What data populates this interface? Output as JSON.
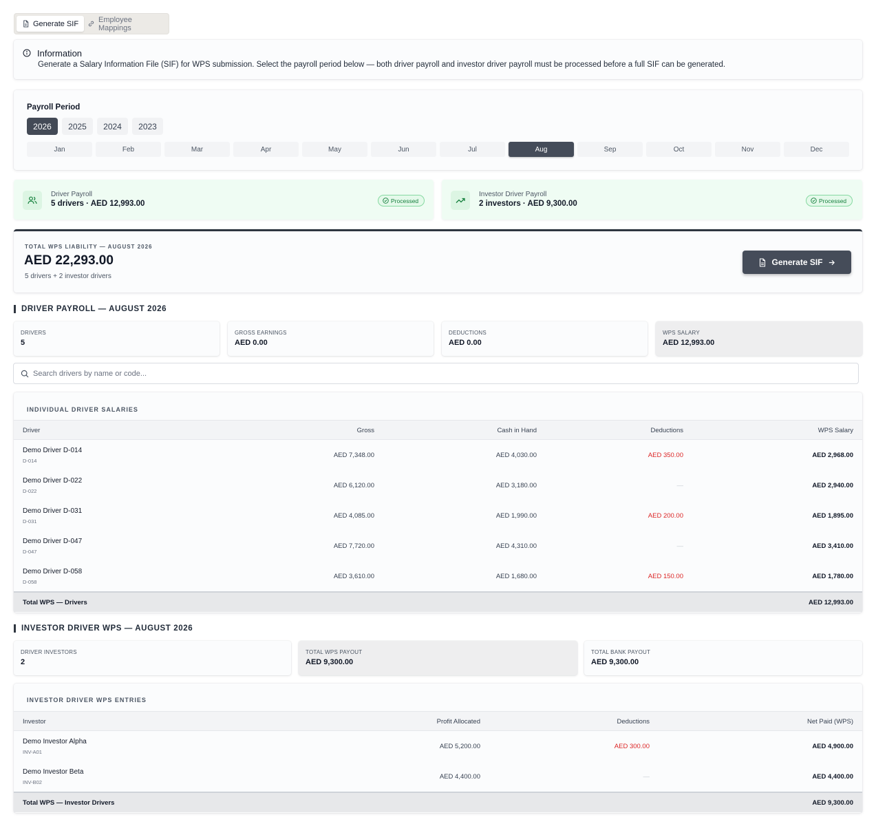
{
  "tabs": [
    {
      "label": "Generate SIF",
      "icon": "file-icon",
      "active": true
    },
    {
      "label": "Employee Mappings",
      "icon": "link-icon",
      "active": false
    }
  ],
  "info": {
    "title": "Information",
    "text": "Generate a Salary Information File (SIF) for WPS submission. Select the payroll period below — both driver payroll and investor driver payroll must be processed before a full SIF can be generated."
  },
  "period": {
    "label": "Payroll Period",
    "years": [
      "2026",
      "2025",
      "2024",
      "2023"
    ],
    "selected_year": "2026",
    "months": [
      "Jan",
      "Feb",
      "Mar",
      "Apr",
      "May",
      "Jun",
      "Jul",
      "Aug",
      "Sep",
      "Oct",
      "Nov",
      "Dec"
    ],
    "selected_month": "Aug"
  },
  "status": {
    "driver": {
      "label": "Driver Payroll",
      "value": "5 drivers · AED 12,993.00",
      "badge": "Processed",
      "icon": "users-icon"
    },
    "investor": {
      "label": "Investor Driver Payroll",
      "value": "2 investors · AED 9,300.00",
      "badge": "Processed",
      "icon": "trending-up-icon"
    }
  },
  "total": {
    "kicker": "TOTAL WPS LIABILITY — AUGUST 2026",
    "amount": "AED 22,293.00",
    "sub": "5 drivers + 2 investor drivers",
    "button": "Generate SIF"
  },
  "driver_section": {
    "title": "DRIVER PAYROLL — AUGUST 2026",
    "stats": [
      {
        "label": "DRIVERS",
        "value": "5"
      },
      {
        "label": "GROSS EARNINGS",
        "value": "AED 0.00"
      },
      {
        "label": "DEDUCTIONS",
        "value": "AED 0.00"
      },
      {
        "label": "WPS SALARY",
        "value": "AED 12,993.00"
      }
    ],
    "search_placeholder": "Search drivers by name or code...",
    "table_title": "INDIVIDUAL DRIVER SALARIES",
    "columns": [
      "Driver",
      "Gross",
      "Cash in Hand",
      "Deductions",
      "WPS Salary"
    ],
    "rows": [
      {
        "name": "Demo Driver D-014",
        "code": "D-014",
        "gross": "AED 7,348.00",
        "cash": "AED 4,030.00",
        "deductions": "AED 350.00",
        "wps": "AED 2,968.00"
      },
      {
        "name": "Demo Driver D-022",
        "code": "D-022",
        "gross": "AED 6,120.00",
        "cash": "AED 3,180.00",
        "deductions": "—",
        "wps": "AED 2,940.00"
      },
      {
        "name": "Demo Driver D-031",
        "code": "D-031",
        "gross": "AED 4,085.00",
        "cash": "AED 1,990.00",
        "deductions": "AED 200.00",
        "wps": "AED 1,895.00"
      },
      {
        "name": "Demo Driver D-047",
        "code": "D-047",
        "gross": "AED 7,720.00",
        "cash": "AED 4,310.00",
        "deductions": "—",
        "wps": "AED 3,410.00"
      },
      {
        "name": "Demo Driver D-058",
        "code": "D-058",
        "gross": "AED 3,610.00",
        "cash": "AED 1,680.00",
        "deductions": "AED 150.00",
        "wps": "AED 1,780.00"
      }
    ],
    "total_label": "Total WPS — Drivers",
    "total_value": "AED 12,993.00"
  },
  "investor_section": {
    "title": "INVESTOR DRIVER WPS — AUGUST 2026",
    "stats": [
      {
        "label": "DRIVER INVESTORS",
        "value": "2"
      },
      {
        "label": "TOTAL WPS PAYOUT",
        "value": "AED 9,300.00"
      },
      {
        "label": "TOTAL BANK PAYOUT",
        "value": "AED 9,300.00"
      }
    ],
    "table_title": "INVESTOR DRIVER WPS ENTRIES",
    "columns": [
      "Investor",
      "Profit Allocated",
      "Deductions",
      "Net Paid (WPS)"
    ],
    "rows": [
      {
        "name": "Demo Investor Alpha",
        "code": "INV-A01",
        "profit": "AED 5,200.00",
        "deductions": "AED 300.00",
        "net": "AED 4,900.00"
      },
      {
        "name": "Demo Investor Beta",
        "code": "INV-B02",
        "profit": "AED 4,400.00",
        "deductions": "—",
        "net": "AED 4,400.00"
      }
    ],
    "total_label": "Total WPS — Investor Drivers",
    "total_value": "AED 9,300.00"
  }
}
